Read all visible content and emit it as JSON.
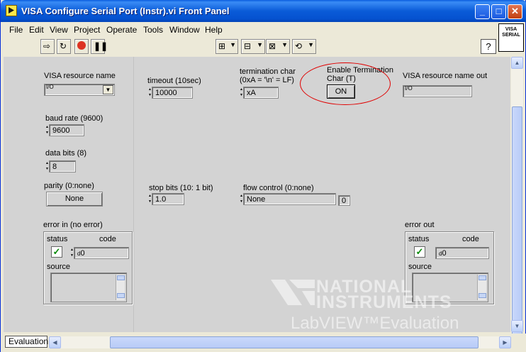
{
  "window": {
    "title": "VISA Configure Serial Port (Instr).vi Front Panel",
    "minimize": "_",
    "maximize": "□",
    "close": "✕"
  },
  "menu": [
    "File",
    "Edit",
    "View",
    "Project",
    "Operate",
    "Tools",
    "Window",
    "Help"
  ],
  "toolbar": {
    "font": "13pt Application Font",
    "help": "?",
    "vi_icon_line1": "VISA",
    "vi_icon_line2": "SERIAL"
  },
  "controls": {
    "visa_resource": {
      "label": "VISA resource name",
      "value": ""
    },
    "timeout": {
      "label": "timeout (10sec)",
      "value": "10000"
    },
    "termchar": {
      "label_line1": "termination char",
      "label_line2": "(0xA = '\\n' = LF)",
      "value": "xA"
    },
    "enable_term": {
      "label_line1": "Enable Termination",
      "label_line2": "Char (T)",
      "value": "ON"
    },
    "visa_out": {
      "label": "VISA resource name out",
      "value": ""
    },
    "baud": {
      "label": "baud rate (9600)",
      "value": "9600"
    },
    "databits": {
      "label": "data bits (8)",
      "value": "8"
    },
    "parity": {
      "label": "parity (0:none)",
      "value": "None"
    },
    "stopbits": {
      "label": "stop bits (10: 1 bit)",
      "value": "1.0"
    },
    "flow": {
      "label": "flow control (0:none)",
      "value": "None",
      "index": "0"
    },
    "error_in": {
      "label": "error in (no error)",
      "status_label": "status",
      "code_label": "code",
      "code": "0",
      "source_label": "source",
      "status_glyph": "✓"
    },
    "error_out": {
      "label": "error out",
      "status_label": "status",
      "code_label": "code",
      "code": "0",
      "source_label": "source",
      "status_glyph": "✓"
    }
  },
  "watermark": {
    "line1": "NATIONAL",
    "line2": "INSTRUMENTS",
    "line3": "LabVIEW™Evaluation Software"
  },
  "status": {
    "mode": "Evaluation"
  },
  "colors": {
    "panel": "#d3d3d3",
    "annotation": "#e00000",
    "titlebar": "#0a5ddf"
  }
}
